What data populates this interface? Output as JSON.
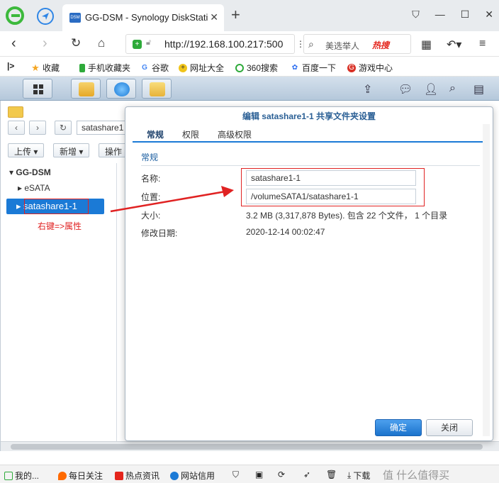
{
  "browser": {
    "tab_title": "GG-DSM - Synology DiskStati",
    "tab_favicon_text": "DSM",
    "address": "http://192.168.100.217:500",
    "search_placeholder": "美选举人",
    "search_hot": "热搜",
    "window_controls": [
      "shirt-icon",
      "minimize-icon",
      "maximize-icon",
      "close-icon"
    ]
  },
  "bookmarks": [
    {
      "label": "收藏",
      "icon": "star-icon",
      "color": "#f5a623"
    },
    {
      "label": "手机收藏夹",
      "icon": "phone-icon",
      "color": "#2eaa3a"
    },
    {
      "label": "谷歌",
      "icon": "google-icon",
      "color": "#4285f4"
    },
    {
      "label": "网址大全",
      "icon": "plus-circle-icon",
      "color": "#f0c419"
    },
    {
      "label": "360搜索",
      "icon": "360-icon",
      "color": "#2eaa3a"
    },
    {
      "label": "百度一下",
      "icon": "baidu-paw-icon",
      "color": "#2a6cf0"
    },
    {
      "label": "游戏中心",
      "icon": "game-icon",
      "color": "#d93025"
    }
  ],
  "dsm": {
    "toolbar": {
      "upload": "上传 ▾",
      "create": "新增 ▾",
      "action": "操作"
    },
    "path": "satashare1",
    "tree": {
      "root": "GG-DSM",
      "items": [
        "eSATA",
        "satashare1-1"
      ]
    },
    "annotation": "右键=>属性"
  },
  "dialog": {
    "title": "编辑 satashare1-1 共享文件夹设置",
    "tabs": [
      "常规",
      "权限",
      "高级权限"
    ],
    "section": "常规",
    "fields": {
      "name_label": "名称:",
      "name_value": "satashare1-1",
      "location_label": "位置:",
      "location_value": "/volumeSATA1/satashare1-1",
      "size_label": "大小:",
      "size_value": "3.2 MB (3,317,878 Bytes). 包含 22 个文件， 1 个目录",
      "modified_label": "修改日期:",
      "modified_value": "2020-12-14 00:02:47"
    },
    "ok": "确定",
    "cancel": "关闭"
  },
  "statusbar": [
    {
      "label": "我的...",
      "color": "#2eaa3a"
    },
    {
      "label": "每日关注",
      "color": "#ff6a00"
    },
    {
      "label": "热点资讯",
      "color": "#e4251c"
    },
    {
      "label": "网站信用",
      "color": "#1b7ad6"
    },
    {
      "label": "下载",
      "color": "#444444"
    }
  ],
  "watermark": "值 什么值得买"
}
